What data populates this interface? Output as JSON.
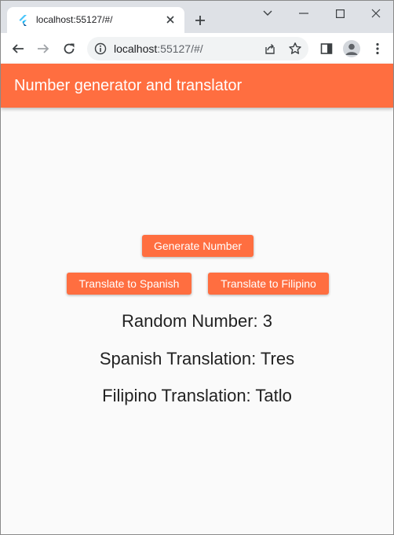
{
  "browser": {
    "tab": {
      "title": "localhost:55127/#/",
      "favicon": "flutter-icon"
    },
    "toolbar": {
      "url_host": "localhost",
      "url_rest": ":55127/#/"
    }
  },
  "app": {
    "title": "Number generator and translator",
    "accent": "#ff6e40",
    "buttons": {
      "generate": "Generate Number",
      "translate_spanish": "Translate to Spanish",
      "translate_filipino": "Translate to Filipino"
    },
    "results": {
      "random_number": "Random Number: 3",
      "spanish": "Spanish Translation: Tres",
      "filipino": "Filipino Translation: Tatlo"
    }
  }
}
